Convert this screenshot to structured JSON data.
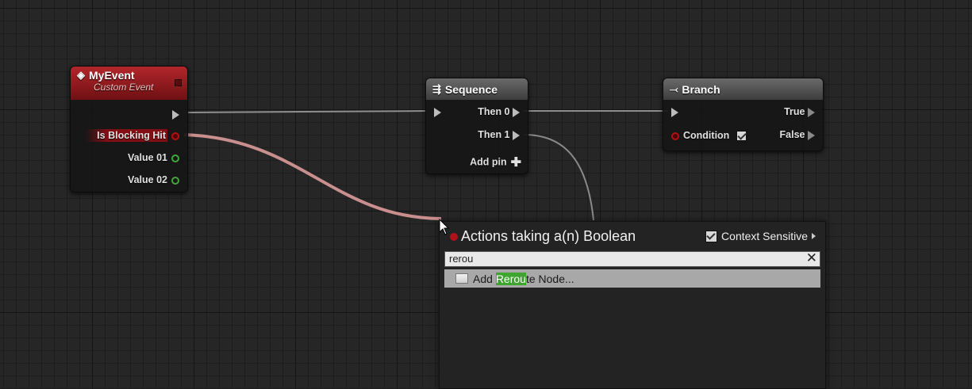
{
  "nodes": {
    "event": {
      "title": "MyEvent",
      "subtitle": "Custom Event",
      "pins": [
        "Is Blocking Hit",
        "Value 01",
        "Value 02"
      ]
    },
    "sequence": {
      "title": "Sequence",
      "pins": [
        "Then 0",
        "Then 1"
      ],
      "add_pin": "Add pin"
    },
    "branch": {
      "title": "Branch",
      "condition": "Condition",
      "true": "True",
      "false": "False"
    }
  },
  "menu": {
    "title": "Actions taking a(n) Boolean",
    "context_sensitive": "Context Sensitive",
    "search_value": "rerou",
    "result": {
      "prefix": "Add ",
      "match": "Rerou",
      "suffix": "te Node..."
    }
  },
  "colors": {
    "boolean_pin": "#b31016",
    "float_pin": "#41a63c",
    "event_header": "#b3262a",
    "match_highlight": "#3ea52f"
  }
}
